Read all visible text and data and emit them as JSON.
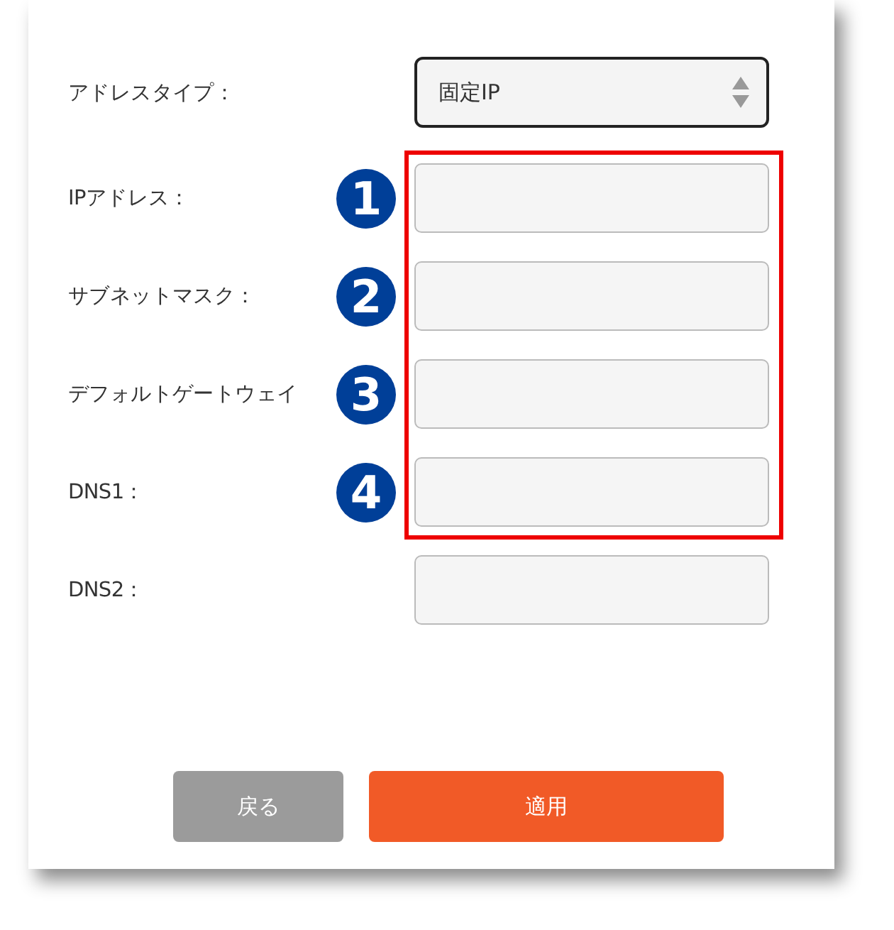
{
  "address_type": {
    "label": "アドレスタイプ：",
    "value": "固定IP"
  },
  "fields": [
    {
      "label": "IPアドレス：",
      "marker": "1",
      "highlighted": true
    },
    {
      "label": "サブネットマスク：",
      "marker": "2",
      "highlighted": true
    },
    {
      "label": "デフォルトゲートウェイ",
      "marker": "3",
      "highlighted": true
    },
    {
      "label": "DNS1：",
      "marker": "4",
      "highlighted": true
    },
    {
      "label": "DNS2：",
      "highlighted": false
    }
  ],
  "buttons": [
    {
      "label": "戻る",
      "kind": "secondary"
    },
    {
      "label": "適用",
      "kind": "primary"
    }
  ]
}
